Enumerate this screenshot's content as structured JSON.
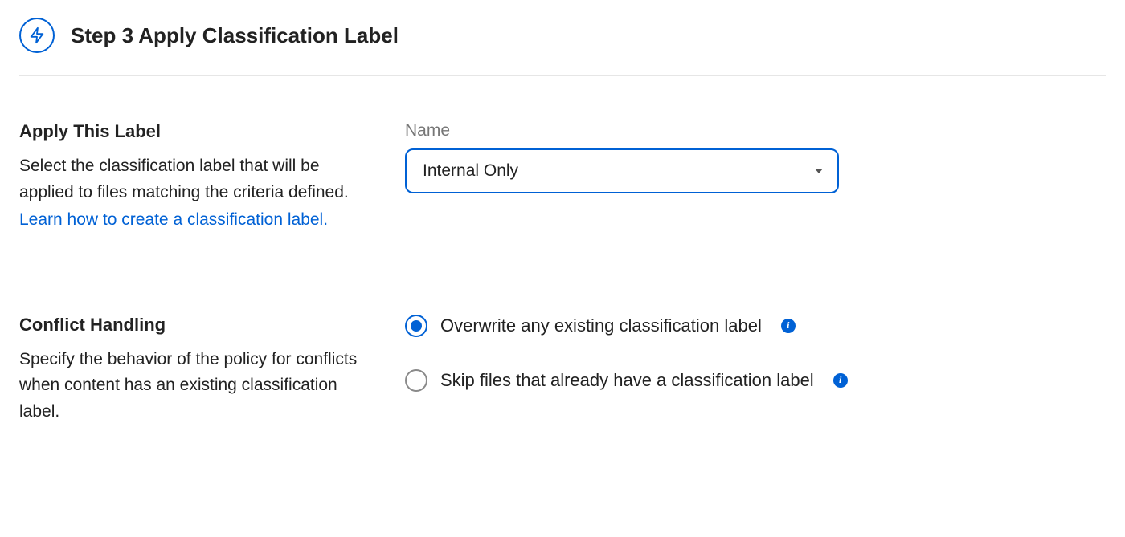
{
  "step": {
    "title": "Step 3 Apply Classification Label"
  },
  "applyLabel": {
    "heading": "Apply This Label",
    "description": "Select the classification label that will be applied to files matching the criteria defined.",
    "linkText": "Learn how to create a classification label.",
    "fieldLabel": "Name",
    "selectedValue": "Internal Only"
  },
  "conflict": {
    "heading": "Conflict Handling",
    "description": "Specify the behavior of the policy for conflicts when content has an existing classification label.",
    "options": [
      {
        "label": "Overwrite any existing classification label",
        "selected": true
      },
      {
        "label": "Skip files that already have a classification label",
        "selected": false
      }
    ]
  }
}
